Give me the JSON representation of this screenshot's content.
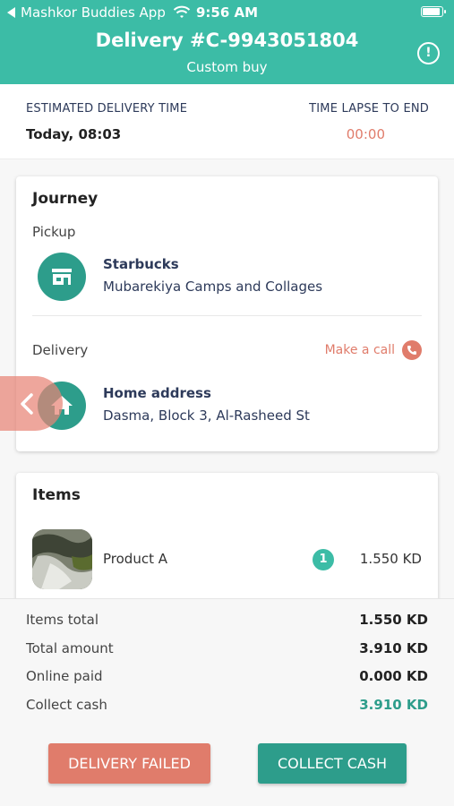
{
  "status_bar": {
    "app_back_label": "Mashkor Buddies App",
    "time": "9:56 AM"
  },
  "header": {
    "title": "Delivery #C-9943051804",
    "subtitle": "Custom buy",
    "info_symbol": "!"
  },
  "estimate": {
    "left_label": "ESTIMATED DELIVERY TIME",
    "left_value": "Today, 08:03",
    "right_label": "TIME LAPSE TO END",
    "right_value": "00:00"
  },
  "journey": {
    "title": "Journey",
    "pickup": {
      "label": "Pickup",
      "name": "Starbucks",
      "address": "Mubarekiya Camps and Collages",
      "icon": "store-icon"
    },
    "delivery": {
      "label": "Delivery",
      "name": "Home address",
      "address": "Dasma, Block 3, Al-Rasheed St",
      "icon": "home-icon"
    },
    "call_label": "Make a call"
  },
  "items": {
    "title": "Items",
    "list": [
      {
        "name": "Product A",
        "qty": "1",
        "price": "1.550 KD"
      }
    ]
  },
  "summary": {
    "rows": [
      {
        "label": "Items total",
        "value": "1.550 KD"
      },
      {
        "label": "Total amount",
        "value": "3.910 KD"
      },
      {
        "label": "Online paid",
        "value": "0.000 KD"
      },
      {
        "label": "Collect cash",
        "value": "3.910 KD"
      }
    ]
  },
  "actions": {
    "fail_label": "DELIVERY FAILED",
    "cash_label": "COLLECT CASH"
  },
  "colors": {
    "primary": "#3cbca6",
    "dark_teal": "#2d9d8b",
    "accent": "#e07c6b"
  }
}
